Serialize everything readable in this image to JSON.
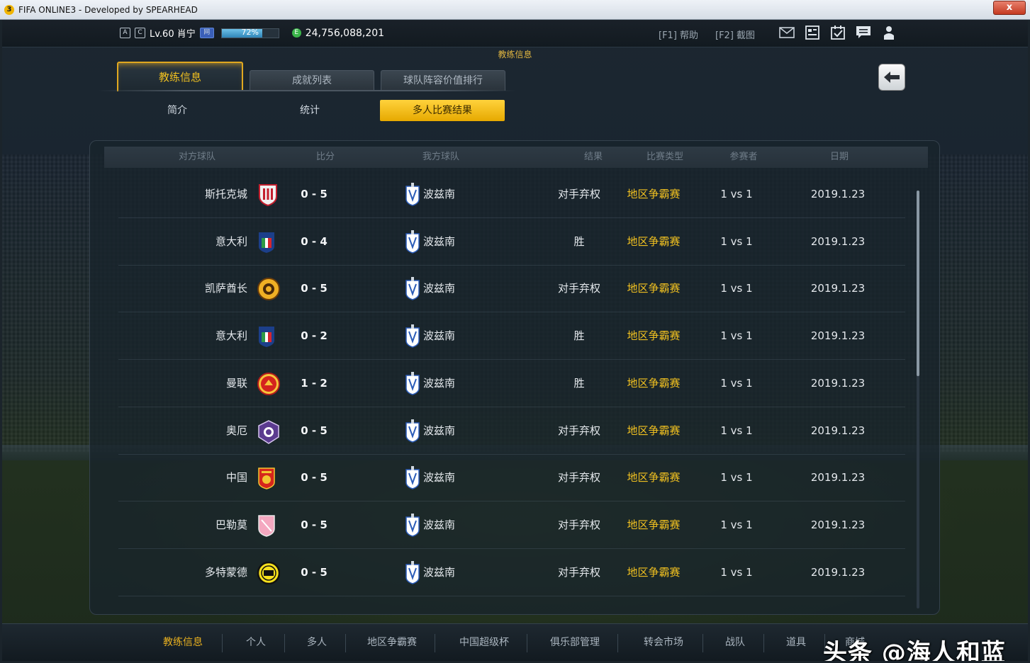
{
  "window": {
    "title": "FIFA ONLINE3 - Developed by SPEARHEAD",
    "close_label": "x"
  },
  "status": {
    "level": "Lv.60 肖宁",
    "xp_percent": 72,
    "xp_label": "72%",
    "coins": "24,756,088,201",
    "help_label": "[F1] 帮助",
    "screenshot_label": "[F2] 截图"
  },
  "header": {
    "caption": "教练信息",
    "tabs": [
      "教练信息",
      "成就列表",
      "球队阵容价值排行"
    ],
    "subtabs": [
      "简介",
      "统计",
      "多人比赛结果"
    ]
  },
  "table": {
    "columns": [
      "对方球队",
      "比分",
      "我方球队",
      "结果",
      "比赛类型",
      "参赛者",
      "日期"
    ],
    "rows": [
      {
        "opponent": "斯托克城",
        "score": "0 - 5",
        "my_team": "波兹南",
        "result": "对手弃权",
        "type": "地区争霸赛",
        "players": "1 vs 1",
        "date": "2019.1.23",
        "crest": "stoke"
      },
      {
        "opponent": "意大利",
        "score": "0 - 4",
        "my_team": "波兹南",
        "result": "胜",
        "type": "地区争霸赛",
        "players": "1 vs 1",
        "date": "2019.1.23",
        "crest": "italy"
      },
      {
        "opponent": "凯萨酋长",
        "score": "0 - 5",
        "my_team": "波兹南",
        "result": "对手弃权",
        "type": "地区争霸赛",
        "players": "1 vs 1",
        "date": "2019.1.23",
        "crest": "chiefs"
      },
      {
        "opponent": "意大利",
        "score": "0 - 2",
        "my_team": "波兹南",
        "result": "胜",
        "type": "地区争霸赛",
        "players": "1 vs 1",
        "date": "2019.1.23",
        "crest": "italy"
      },
      {
        "opponent": "曼联",
        "score": "1 - 2",
        "my_team": "波兹南",
        "result": "胜",
        "type": "地区争霸赛",
        "players": "1 vs 1",
        "date": "2019.1.23",
        "crest": "manutd"
      },
      {
        "opponent": "奥厄",
        "score": "0 - 5",
        "my_team": "波兹南",
        "result": "对手弃权",
        "type": "地区争霸赛",
        "players": "1 vs 1",
        "date": "2019.1.23",
        "crest": "aue"
      },
      {
        "opponent": "中国",
        "score": "0 - 5",
        "my_team": "波兹南",
        "result": "对手弃权",
        "type": "地区争霸赛",
        "players": "1 vs 1",
        "date": "2019.1.23",
        "crest": "china"
      },
      {
        "opponent": "巴勒莫",
        "score": "0 - 5",
        "my_team": "波兹南",
        "result": "对手弃权",
        "type": "地区争霸赛",
        "players": "1 vs 1",
        "date": "2019.1.23",
        "crest": "palermo"
      },
      {
        "opponent": "多特蒙德",
        "score": "0 - 5",
        "my_team": "波兹南",
        "result": "对手弃权",
        "type": "地区争霸赛",
        "players": "1 vs 1",
        "date": "2019.1.23",
        "crest": "dortmund"
      }
    ]
  },
  "bottom_nav": [
    "教练信息",
    "个人",
    "多人",
    "地区争霸赛",
    "中国超级杯",
    "俱乐部管理",
    "转会市场",
    "战队",
    "道具",
    "商城"
  ],
  "watermark": "头条 @海人和蓝",
  "colors": {
    "accent": "#f0c020",
    "panel": "#18242c"
  }
}
